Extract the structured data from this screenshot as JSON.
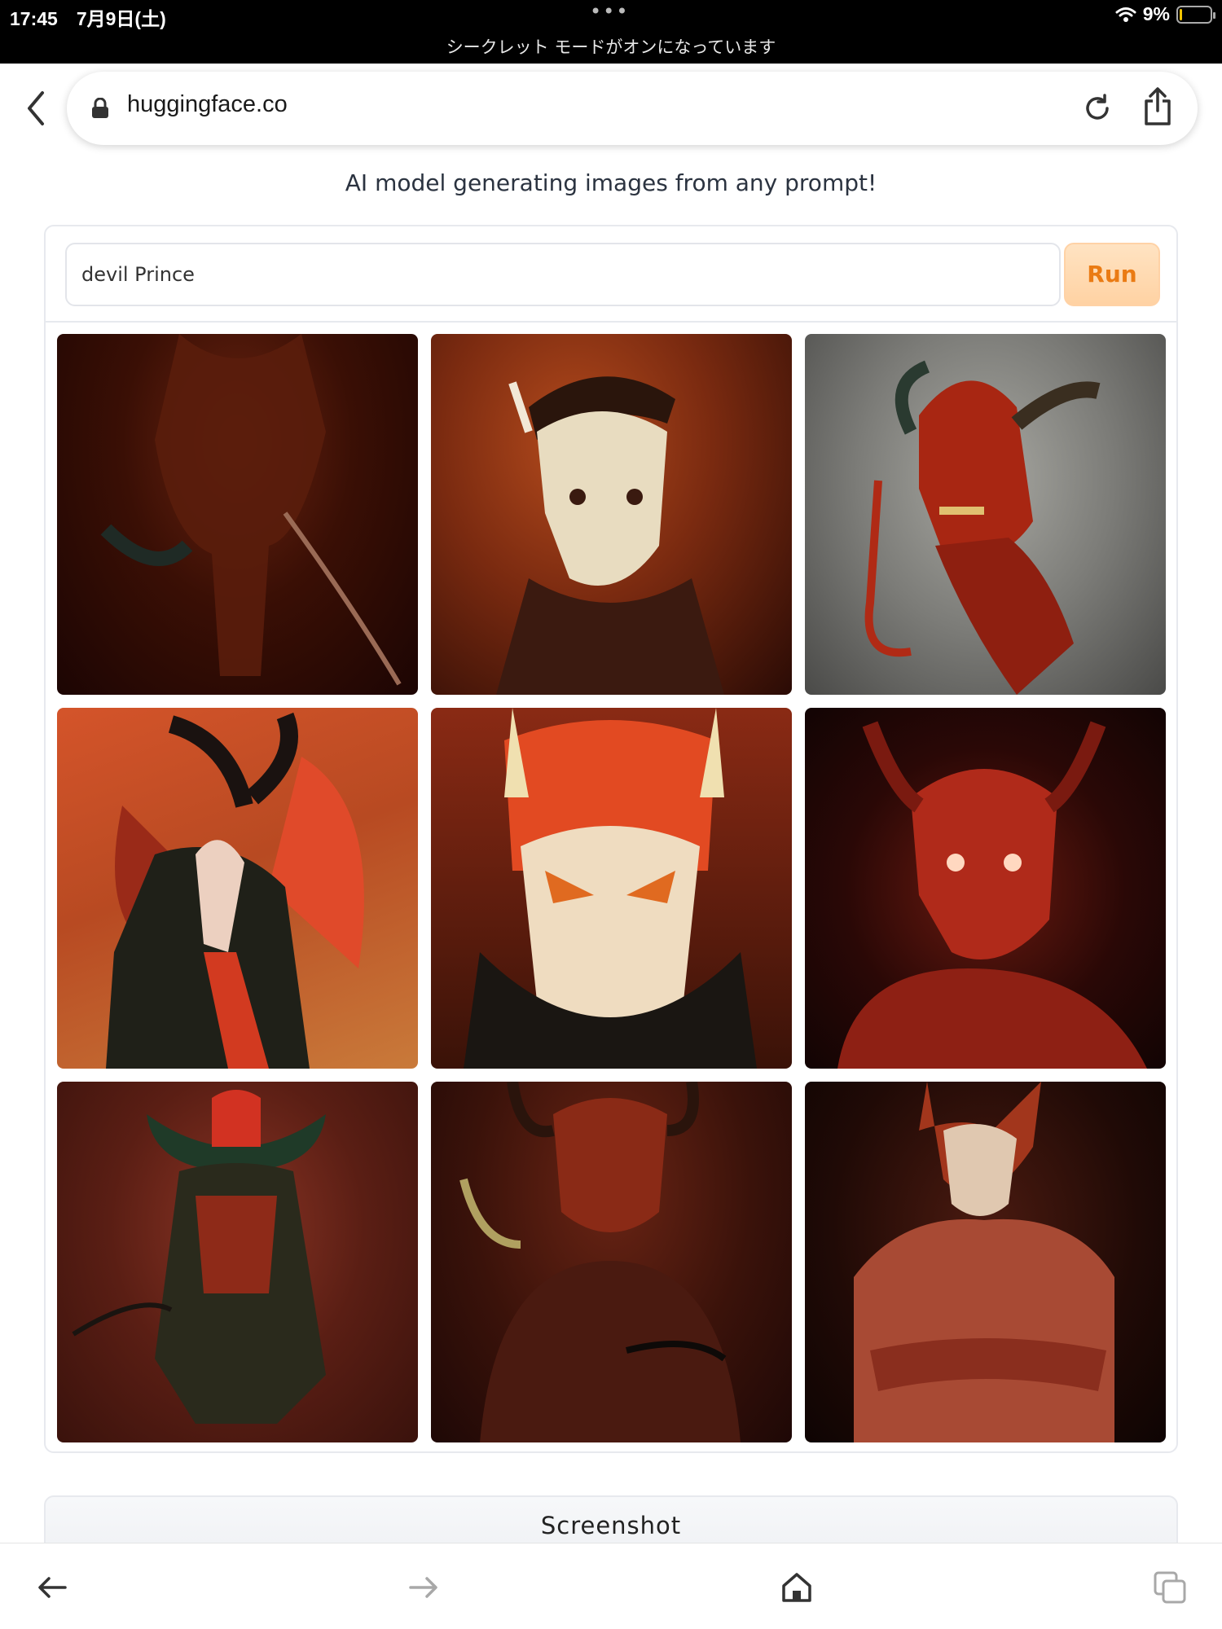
{
  "status_bar": {
    "time_date": "17:45　7月9日(土)",
    "menu_dots": "•••",
    "private_notice": "シークレット モードがオンになっています",
    "battery_percent": "9%",
    "battery_level": 0.09
  },
  "browser": {
    "url": "huggingface.co",
    "icons": [
      "back-chevron-icon",
      "lock-icon",
      "reload-icon",
      "share-icon"
    ]
  },
  "app": {
    "tagline": "AI model generating images from any prompt!",
    "prompt_value": "devil Prince",
    "run_label": "Run",
    "accent_color": "#ea7b14",
    "images": [
      {
        "alt": "generated image 1"
      },
      {
        "alt": "generated image 2"
      },
      {
        "alt": "generated image 3"
      },
      {
        "alt": "generated image 4"
      },
      {
        "alt": "generated image 5"
      },
      {
        "alt": "generated image 6"
      },
      {
        "alt": "generated image 7"
      },
      {
        "alt": "generated image 8"
      },
      {
        "alt": "generated image 9"
      }
    ],
    "screenshot_label": "Screenshot"
  },
  "toolbar": {
    "icons": [
      "back-arrow-icon",
      "forward-arrow-icon",
      "home-icon",
      "tabs-icon"
    ]
  }
}
